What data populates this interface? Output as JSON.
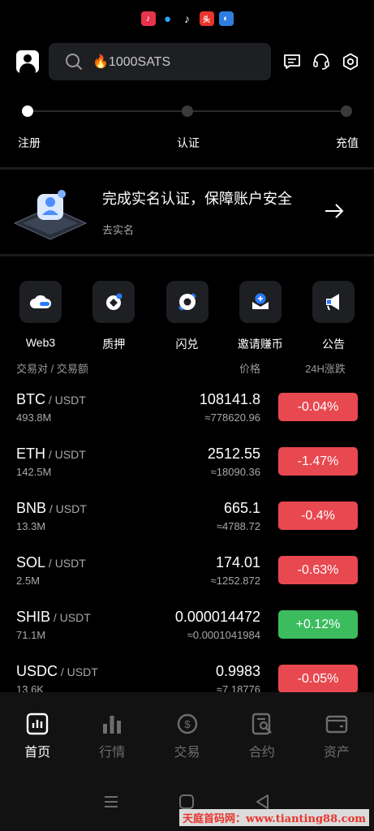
{
  "search": {
    "placeholder_text": "🔥1000SATS"
  },
  "progress": {
    "steps": [
      "注册",
      "认证",
      "充值"
    ]
  },
  "kyc": {
    "title": "完成实名认证，保障账户安全",
    "subtitle": "去实名"
  },
  "quick_actions": [
    "Web3",
    "质押",
    "闪兑",
    "邀请赚币",
    "公告"
  ],
  "market": {
    "header": {
      "pair": "交易对 / 交易额",
      "price": "价格",
      "change": "24H涨跌"
    },
    "rows": [
      {
        "symbol": "BTC",
        "quote": " / USDT",
        "volume": "493.8M",
        "price": "108141.8",
        "cny": "≈778620.96",
        "change": "-0.04%",
        "direction": "down"
      },
      {
        "symbol": "ETH",
        "quote": " / USDT",
        "volume": "142.5M",
        "price": "2512.55",
        "cny": "≈18090.36",
        "change": "-1.47%",
        "direction": "down"
      },
      {
        "symbol": "BNB",
        "quote": " / USDT",
        "volume": "13.3M",
        "price": "665.1",
        "cny": "≈4788.72",
        "change": "-0.4%",
        "direction": "down"
      },
      {
        "symbol": "SOL",
        "quote": " / USDT",
        "volume": "2.5M",
        "price": "174.01",
        "cny": "≈1252.872",
        "change": "-0.63%",
        "direction": "down"
      },
      {
        "symbol": "SHIB",
        "quote": " / USDT",
        "volume": "71.1M",
        "price": "0.000014472",
        "cny": "≈0.0001041984",
        "change": "+0.12%",
        "direction": "up"
      },
      {
        "symbol": "USDC",
        "quote": " / USDT",
        "volume": "13.6K",
        "price": "0.9983",
        "cny": "≈7.18776",
        "change": "-0.05%",
        "direction": "down"
      }
    ]
  },
  "tabbar": {
    "tabs": [
      "首页",
      "行情",
      "交易",
      "合约",
      "资产"
    ],
    "active_index": 0
  },
  "watermark": "天庭首码网：www.tianting88.com",
  "colors": {
    "up": "#3bbd5e",
    "down": "#e84850",
    "background": "#000000",
    "card": "#1e1f23"
  },
  "icons": {
    "status_bar": [
      "music-app-icon",
      "qq-icon",
      "tiktok-icon",
      "news-app-icon",
      "browser-icon"
    ],
    "header": [
      "avatar-icon",
      "search-icon",
      "message-icon",
      "support-icon",
      "settings-icon"
    ],
    "quick_actions": [
      "web3-cloud-icon",
      "staking-icon",
      "swap-icon",
      "invite-icon",
      "announcement-icon"
    ],
    "tabs": [
      "home-icon",
      "market-icon",
      "trade-icon",
      "contract-icon",
      "assets-icon"
    ]
  }
}
